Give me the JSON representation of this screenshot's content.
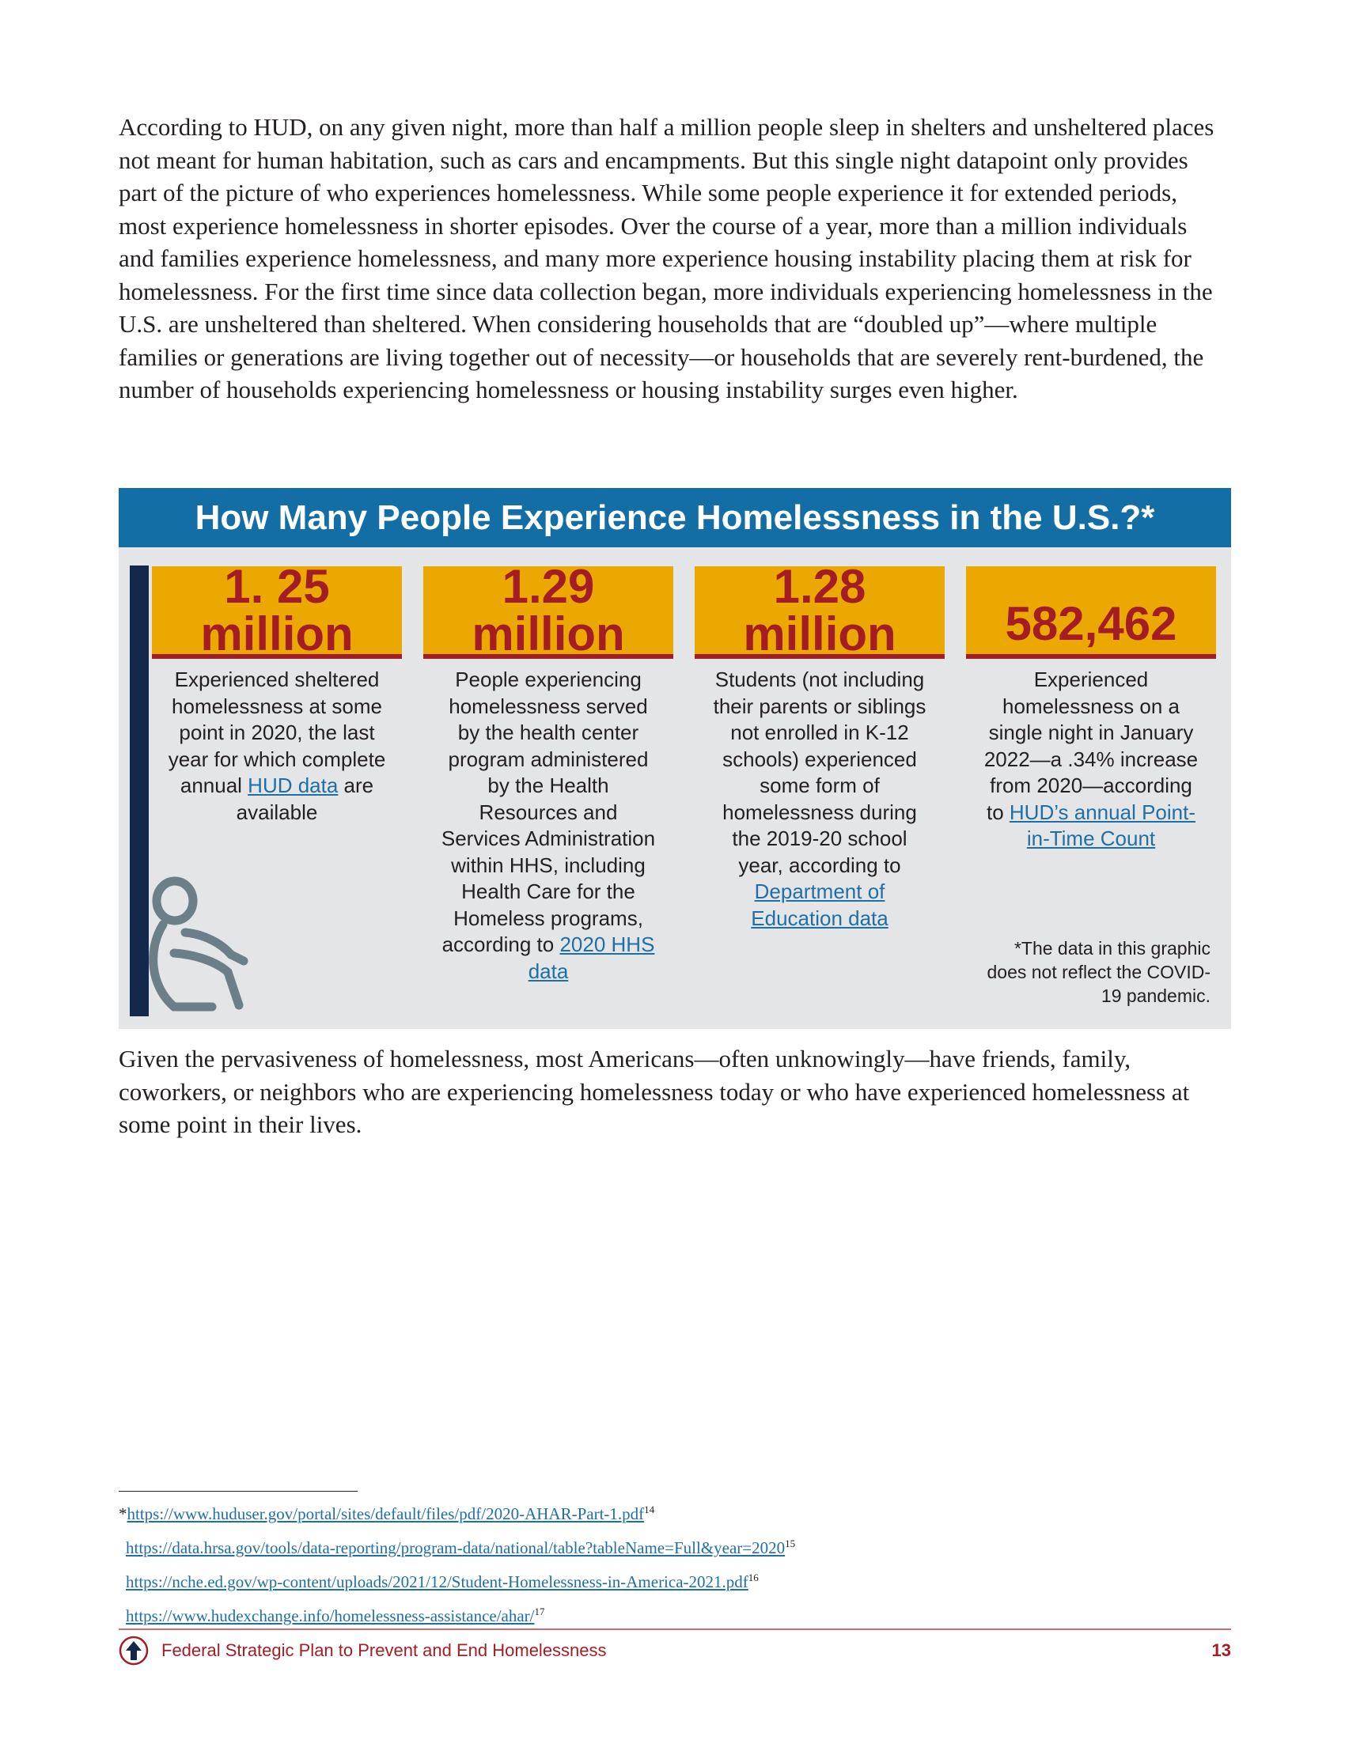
{
  "intro_paragraph": "According to HUD, on any given night, more than half a million people sleep in shelters and unsheltered places not meant for human habitation, such as cars and encampments. But this single night datapoint only provides part of the picture of who experiences homelessness. While some people experience it for extended periods, most experience homelessness in shorter episodes. Over the course of a year, more than a million individuals and families experience homelessness, and many more experience housing instability placing them at risk for homelessness. For the first time since data collection began, more individuals experiencing homelessness in the U.S. are unsheltered than sheltered. When considering households that are “doubled up”—where multiple families or generations are living together out of necessity—or households that are severely rent-burdened, the number of households experiencing homelessness or housing instability surges even higher.",
  "infographic": {
    "title": "How Many People Experience Homelessness in the U.S.?*",
    "colors": {
      "header": "#136ea6",
      "stat_box": "#eaa800",
      "stat_text": "#a51d24",
      "panel": "#e4e5e7",
      "accent_bar": "#13294b"
    },
    "stats": [
      {
        "value": "1. 25 million",
        "desc_before": "Experienced sheltered homelessness at some point in 2020, the last year for which complete annual ",
        "link": "HUD data",
        "desc_after": " are available"
      },
      {
        "value": "1.29 million",
        "desc_before": "People experiencing homelessness served by the health center program administered by the Health Resources and Services Administration within HHS, including Health Care for the Homeless programs, according to ",
        "link": "2020 HHS data",
        "desc_after": ""
      },
      {
        "value": "1.28 million",
        "desc_before": "Students (not including their parents or siblings not enrolled in K-12 schools) experienced some form of homelessness during the 2019-20 school year, according to ",
        "link": "Department of Education data",
        "desc_after": ""
      },
      {
        "value": "582,462",
        "desc_before": "Experienced homelessness on a single night in January 2022—a .34% increase from 2020—according to ",
        "link": "HUD’s annual Point-in-Time Count",
        "desc_after": ""
      }
    ],
    "note": "*The data in this graphic does not reflect the COVID-19 pandemic.",
    "icon": "person-sitting-hugging-knees-icon"
  },
  "outro_paragraph": "Given the pervasiveness of homelessness, most Americans—often unknowingly—have friends, family, coworkers, or neighbors who are experiencing homelessness today or who have experienced homelessness at some point in their lives.",
  "footnotes": [
    {
      "prefix": "*",
      "url": "https://www.huduser.gov/portal/sites/default/files/pdf/2020-AHAR-Part-1.pdf",
      "num": "14"
    },
    {
      "prefix": "",
      "url": "https://data.hrsa.gov/tools/data-reporting/program-data/national/table?tableName=Full&year=2020",
      "num": "15"
    },
    {
      "prefix": "",
      "url": "https://nche.ed.gov/wp-content/uploads/2021/12/Student-Homelessness-in-America-2021.pdf",
      "num": "16"
    },
    {
      "prefix": "",
      "url": "https://www.hudexchange.info/homelessness-assistance/ahar/",
      "num": "17"
    }
  ],
  "footer": {
    "title": "Federal Strategic Plan to Prevent and End Homelessness",
    "page_number": "13",
    "logo_icon": "up-arrow-circle-icon"
  }
}
